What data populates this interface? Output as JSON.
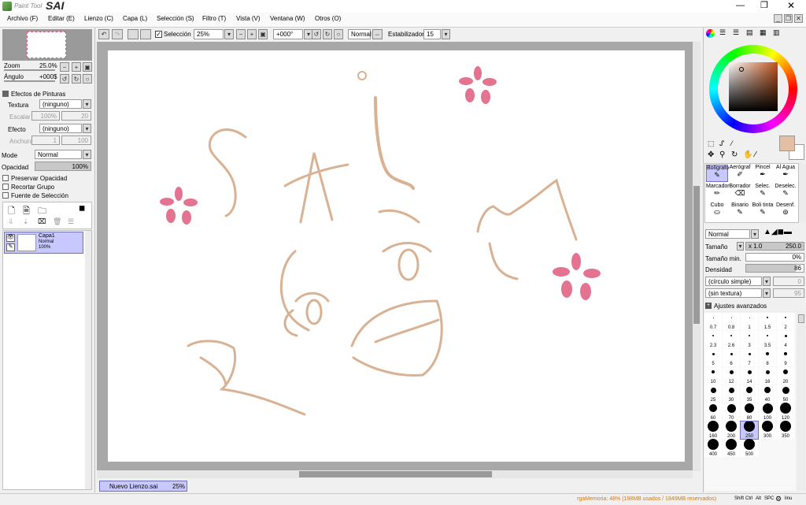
{
  "app": {
    "logo_small": "Paint Tool",
    "logo_big": "SAI"
  },
  "menu": [
    "Archivo (F)",
    "Editar (E)",
    "Lienzo (C)",
    "Capa (L)",
    "Selección (S)",
    "Filtro (T)",
    "Vista (V)",
    "Ventana (W)",
    "Otros (O)"
  ],
  "navigator": {
    "zoom_label": "Zoom",
    "zoom_value": "25.0%",
    "angle_label": "Ángulo",
    "angle_value": "+000$"
  },
  "paint_effects": {
    "header": "Efectos de Pinturas",
    "texture_label": "Textura",
    "texture_value": "(ninguno)",
    "scale_label": "Escalar",
    "scale_value": "100%",
    "scale_num": "20",
    "effect_label": "Efecto",
    "effect_value": "(ninguno)",
    "width_label": "Anchura",
    "width_value": "1",
    "width_num": "100"
  },
  "layer_props": {
    "mode_label": "Mode",
    "mode_value": "Normal",
    "opacity_label": "Opacidad",
    "opacity_value": "100%",
    "preserve_opacity": "Preservar Opacidad",
    "clip_group": "Recortar Grupo",
    "selection_source": "Fuente de Selección"
  },
  "layer": {
    "name": "Capa1",
    "mode": "Normal",
    "opacity": "100%"
  },
  "toolbar": {
    "selection_label": "Selección",
    "zoom": "25%",
    "angle": "+000°",
    "mode": "Normal",
    "stabilizer_label": "Estabilizador",
    "stabilizer_value": "15"
  },
  "doc_tab": {
    "name": "Nuevo Lienzo.sai",
    "zoom": "25%"
  },
  "status": {
    "memory": "rgaMemoria: 48% (198MB usados / 1849MB reservados)",
    "keys": [
      "Shift",
      "Ctrl",
      "Alt",
      "SPC"
    ],
    "extra": "linu"
  },
  "tools": {
    "row1": [
      "Bolígrafo",
      "Aerógraf",
      "Pincel",
      "Al Agua"
    ],
    "row2": [
      "Marcador",
      "Borrador",
      "Selec.",
      "Deselec."
    ],
    "row3": [
      "Cubo",
      "Binario",
      "Boli tinta",
      "Desenf."
    ]
  },
  "brush": {
    "mode": "Normal",
    "size_label": "Tamaño",
    "size_mult": "x 1.0",
    "size_value": "250.0",
    "min_size_label": "Tamaño min.",
    "min_size_value": "0%",
    "density_label": "Densidad",
    "density_value": "86",
    "shape": "(círculo simple)",
    "shape_num": "0",
    "texture": "(sin textura)",
    "texture_num": "95",
    "advanced": "Ajustes avanzados"
  },
  "sizes": [
    "0.7",
    "0.8",
    "1",
    "1.5",
    "2",
    "2.3",
    "2.6",
    "3",
    "3.5",
    "4",
    "5",
    "6",
    "7",
    "8",
    "9",
    "10",
    "12",
    "14",
    "16",
    "20",
    "25",
    "30",
    "35",
    "40",
    "50",
    "60",
    "70",
    "80",
    "100",
    "120",
    "160",
    "200",
    "250",
    "300",
    "350",
    "400",
    "450",
    "500"
  ],
  "selected_size": "250",
  "colors": {
    "main": "#e4bfa4",
    "sub": "#ffffff",
    "stroke": "#d9b193",
    "petal": "#e05a7e"
  },
  "canvas_text": "SAI"
}
